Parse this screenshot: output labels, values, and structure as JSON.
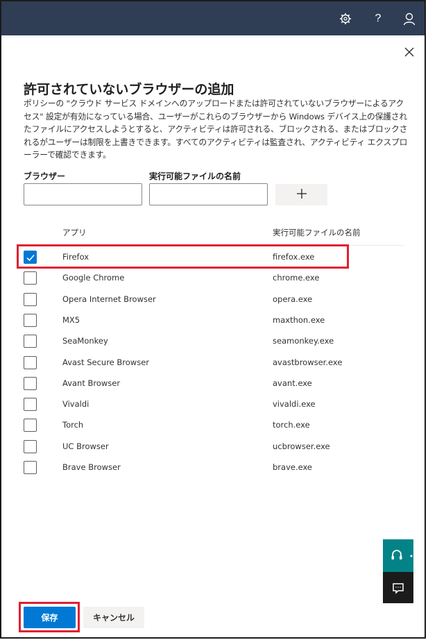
{
  "header_icons": [
    "gear-icon",
    "help-icon",
    "user-icon"
  ],
  "header_help_glyph": "?",
  "dialog": {
    "title": "許可されていないブラウザーの追加",
    "description": "ポリシーの \"クラウド サービス ドメインへのアップロードまたは許可されていないブラウザーによるアクセス\" 設定が有効になっている場合、ユーザーがこれらのブラウザーから Windows デバイス上の保護されたファイルにアクセスしようとすると、アクティビティは許可される、ブロックされる、またはブロックされるがユーザーは制限を上書きできます。すべてのアクティビティは監査され、アクティビティ エクスプローラーで確認できます。"
  },
  "form": {
    "browser_label": "ブラウザー",
    "browser_value": "",
    "exe_label": "実行可能ファイルの名前",
    "exe_value": "",
    "add_icon": "plus-icon"
  },
  "table": {
    "headers": {
      "app": "アプリ",
      "exe": "実行可能ファイルの名前"
    },
    "rows": [
      {
        "app": "Firefox",
        "exe": "firefox.exe",
        "checked": true
      },
      {
        "app": "Google Chrome",
        "exe": "chrome.exe",
        "checked": false
      },
      {
        "app": "Opera Internet Browser",
        "exe": "opera.exe",
        "checked": false
      },
      {
        "app": "MX5",
        "exe": "maxthon.exe",
        "checked": false
      },
      {
        "app": "SeaMonkey",
        "exe": "seamonkey.exe",
        "checked": false
      },
      {
        "app": "Avast Secure Browser",
        "exe": "avastbrowser.exe",
        "checked": false
      },
      {
        "app": "Avant Browser",
        "exe": "avant.exe",
        "checked": false
      },
      {
        "app": "Vivaldi",
        "exe": "vivaldi.exe",
        "checked": false
      },
      {
        "app": "Torch",
        "exe": "torch.exe",
        "checked": false
      },
      {
        "app": "UC Browser",
        "exe": "ucbrowser.exe",
        "checked": false
      },
      {
        "app": "Brave Browser",
        "exe": "brave.exe",
        "checked": false
      }
    ]
  },
  "footer": {
    "save_label": "保存",
    "cancel_label": "キャンセル"
  },
  "colors": {
    "topbar": "#2f3e55",
    "primary": "#0078d4",
    "highlight": "#e02030",
    "support": "#038387"
  }
}
